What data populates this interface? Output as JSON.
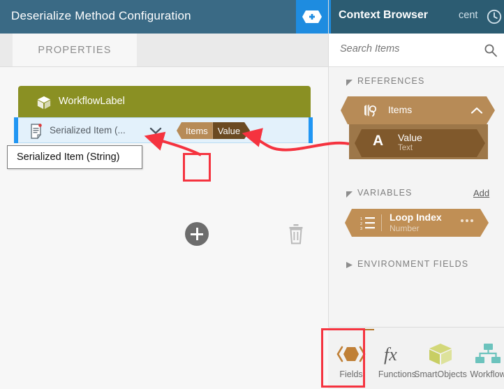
{
  "dialog": {
    "title": "Deserialize Method Configuration",
    "add_icon": "hex-plus-icon",
    "tabs": [
      {
        "label": "PROPERTIES",
        "active": true
      }
    ],
    "card": {
      "icon": "cube-icon",
      "label": "WorkflowLabel"
    },
    "selected_row": {
      "icon": "document-list-icon",
      "label": "Serialized Item (...",
      "dropdown_icon": "chevron-down-icon",
      "chip": {
        "left": "Items",
        "right": "Value"
      }
    },
    "tooltip": "Serialized Item (String)",
    "add_row_button": "plus-icon",
    "delete_button": "trash-icon"
  },
  "context_browser": {
    "title": "Context Browser",
    "recent_label": "cent",
    "recent_icon": "clock-icon",
    "search": {
      "placeholder": "Search Items",
      "value": "",
      "icon": "search-icon"
    },
    "sections": [
      {
        "caption": "REFERENCES",
        "expanded": true,
        "toggle_icon": "triangle-down-icon",
        "action": ""
      },
      {
        "caption": "VARIABLES",
        "expanded": true,
        "toggle_icon": "triangle-down-icon",
        "action": "Add"
      },
      {
        "caption": "ENVIRONMENT FIELDS",
        "expanded": false,
        "toggle_icon": "triangle-right-icon",
        "action": ""
      }
    ],
    "references": {
      "items_node": {
        "icon": "references-icon",
        "label": "Items",
        "collapse_icon": "chevron-up-icon"
      },
      "children": [
        {
          "badge": "A",
          "label": "Value",
          "type": "Text"
        }
      ]
    },
    "variables": [
      {
        "icon": "numbered-list-icon",
        "label": "Loop Index",
        "type": "Number",
        "menu_icon": "ellipsis-icon"
      }
    ]
  },
  "bottom_toolbar": {
    "tabs": [
      {
        "label": "Fields",
        "icon": "hex-fields-icon",
        "active": true
      },
      {
        "label": "Functions",
        "icon": "fx-icon",
        "active": false
      },
      {
        "label": "SmartObjects",
        "icon": "cube-icon",
        "active": false
      },
      {
        "label": "Workflow",
        "icon": "workflow-icon",
        "active": false
      }
    ]
  },
  "colors": {
    "dialog_header": "#3a6a85",
    "add_button": "#1e8ce0",
    "card_green": "#8a9023",
    "selection_blue": "#2196f3",
    "selection_fill": "#e3f1fb",
    "chip_left": "#b78b57",
    "chip_right": "#6b4a22",
    "cb_header": "#2c5c72",
    "reference_brown": "#b78b57",
    "reference_child_brown": "#80592c",
    "variable_tan": "#c08f55",
    "annotation_red": "#f5333f"
  }
}
